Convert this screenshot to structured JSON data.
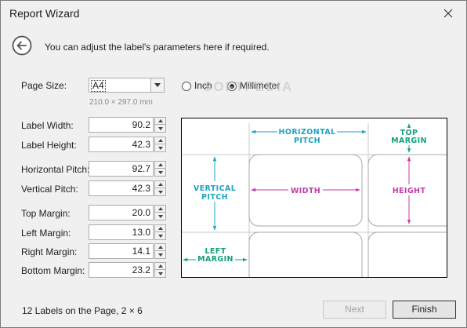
{
  "window": {
    "title": "Report Wizard"
  },
  "icons": {
    "close": "close-icon",
    "back": "back-arrow-icon",
    "dropdown": "chevron-down-icon",
    "spin_up": "spin-up-icon",
    "spin_down": "spin-down-icon"
  },
  "intro": "You can adjust the label's parameters here if required.",
  "page_size": {
    "label": "Page Size:",
    "value": "A4",
    "dimensions": "210.0 × 297.0 mm",
    "units": [
      {
        "label": "Inch",
        "selected": false
      },
      {
        "label": "Millimeter",
        "selected": true
      }
    ]
  },
  "watermark": "SOFTPEDIA",
  "params": {
    "label_width": {
      "label": "Label Width:",
      "value": "90.2"
    },
    "label_height": {
      "label": "Label Height:",
      "value": "42.3"
    },
    "horizontal_pitch": {
      "label": "Horizontal Pitch:",
      "value": "92.7"
    },
    "vertical_pitch": {
      "label": "Vertical Pitch:",
      "value": "42.3"
    },
    "top_margin": {
      "label": "Top Margin:",
      "value": "20.0"
    },
    "left_margin": {
      "label": "Left Margin:",
      "value": "13.0"
    },
    "right_margin": {
      "label": "Right Margin:",
      "value": "14.1"
    },
    "bottom_margin": {
      "label": "Bottom Margin:",
      "value": "23.2"
    }
  },
  "preview": {
    "horizontal_pitch": [
      "HORIZONTAL",
      "PITCH"
    ],
    "top_margin": [
      "TOP",
      "MARGIN"
    ],
    "vertical_pitch": [
      "VERTICAL",
      "PITCH"
    ],
    "width": "WIDTH",
    "height": "HEIGHT",
    "left_margin": [
      "LEFT",
      "MARGIN"
    ],
    "colors": {
      "cyan": "#1fa3c4",
      "green": "#13a07c",
      "magenta": "#c33ca8"
    }
  },
  "footer": {
    "summary": "12 Labels on the Page, 2 × 6",
    "next_label": "Next",
    "finish_label": "Finish"
  }
}
